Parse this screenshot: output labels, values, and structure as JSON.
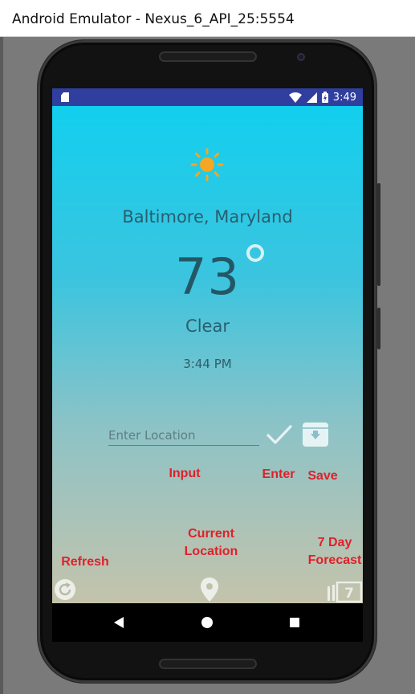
{
  "window": {
    "title": "Android Emulator - Nexus_6_API_25:5554"
  },
  "statusbar": {
    "time": "3:49",
    "icons": [
      "sim-card-icon",
      "wifi-icon",
      "cell-signal-icon",
      "battery-charging-icon"
    ]
  },
  "weather": {
    "icon": "sun-icon",
    "city": "Baltimore, Maryland",
    "temperature": "73",
    "condition": "Clear",
    "time": "3:44 PM"
  },
  "location_input": {
    "placeholder": "Enter Location",
    "value": ""
  },
  "buttons": {
    "enter_icon": "checkmark-icon",
    "save_icon": "archive-icon",
    "refresh_icon": "refresh-icon",
    "location_icon": "location-pin-icon",
    "forecast_icon": "calendar-7-icon",
    "forecast_number": "7"
  },
  "annotations": {
    "input": "Input",
    "enter": "Enter",
    "save": "Save",
    "refresh": "Refresh",
    "current_location": "Current Location",
    "seven_day_forecast": "7 Day Forecast"
  },
  "colors": {
    "statusbar": "#303f9f",
    "gradient_top": "#12cfee",
    "gradient_bottom": "#c4c3ab",
    "sun": "#f5a623",
    "annotation": "#e0202a"
  },
  "navbar": {
    "icons": [
      "back-icon",
      "home-icon",
      "recent-apps-icon"
    ]
  }
}
